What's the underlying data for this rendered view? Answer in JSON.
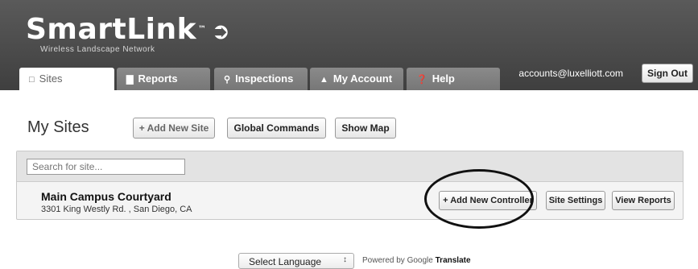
{
  "brand": {
    "name": "SmartLink",
    "tm": "™",
    "tagline": "Wireless Landscape Network"
  },
  "tabs": [
    {
      "label": "Sites",
      "icon": "sites-icon"
    },
    {
      "label": "Reports",
      "icon": "reports-icon"
    },
    {
      "label": "Inspections",
      "icon": "search-icon"
    },
    {
      "label": "My Account",
      "icon": "user-icon"
    },
    {
      "label": "Help",
      "icon": "help-icon"
    }
  ],
  "account": {
    "email": "accounts@luxelliott.com",
    "sign_out": "Sign Out"
  },
  "page": {
    "title": "My Sites",
    "add_site": "+ Add New Site",
    "global_commands": "Global Commands",
    "show_map": "Show Map"
  },
  "search": {
    "placeholder": "Search for site..."
  },
  "site": {
    "name": "Main Campus Courtyard",
    "address": "3301 King Westly Rd. , San Diego, CA",
    "add_controller": "+ Add New Controller",
    "settings": "Site Settings",
    "reports": "View Reports"
  },
  "footer": {
    "language": "Select Language",
    "powered_prefix": "Powered by ",
    "google": "Google",
    "translate": "Translate"
  },
  "colors": {
    "header": "#4a4a4a",
    "tab": "#808080"
  }
}
